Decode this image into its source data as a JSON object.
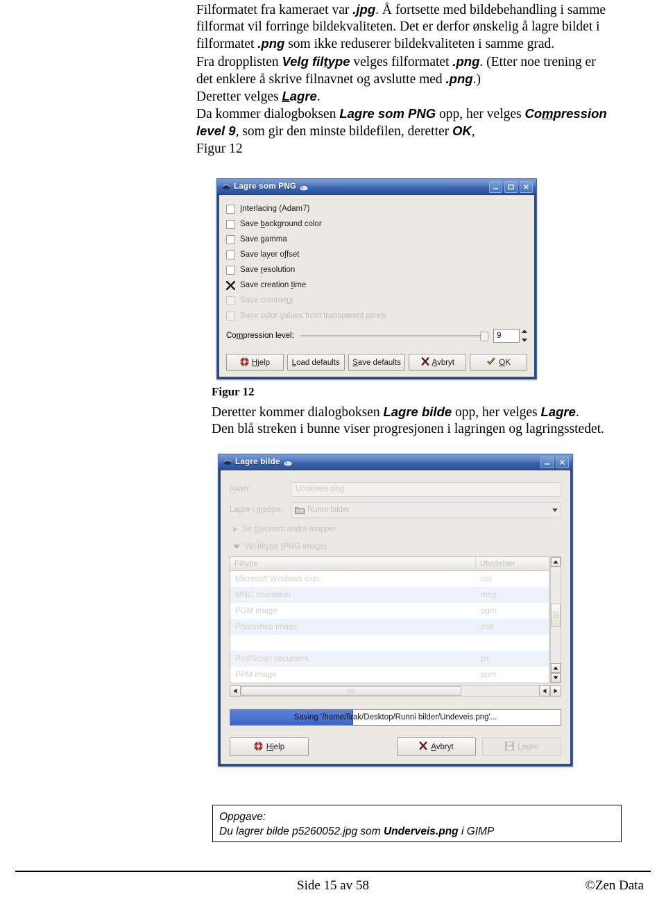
{
  "document": {
    "body_paragraphs": [
      {
        "runs": [
          {
            "t": "Filformatet fra kameraet var ",
            "b": false
          },
          {
            "t": ".jpg",
            "b": true
          },
          {
            "t": ". Å fortsette med bildebehandling i samme filformat vil forringe bildekvaliteten. Det er derfor ønskelig å lagre bildet i filformatet ",
            "b": false
          },
          {
            "t": ".png",
            "b": true
          },
          {
            "t": " som ikke reduserer bildekvaliteten i samme grad.",
            "b": false
          }
        ]
      }
    ],
    "para1_line1": "Filformatet fra kameraet var ",
    "jpg": ".jpg",
    "para1_mid": ". Å fortsette med bildebehandling i samme filformat vil forringe bildekvaliteten. Det er derfor ønskelig å lagre bildet i filformatet ",
    "png1": ".png",
    "para1_end": " som ikke reduserer bildekvaliteten i samme grad.",
    "para2_a": "Fra dropplisten ",
    "velg_filtype": "Velg fil",
    "velg_filtype_u": "t",
    "velg_filtype_rest": "ype",
    "para2_b": " velges filformatet ",
    "png2": ".png",
    "para2_c": ". (Etter noe trening er det enklere å skrive filnavnet og avslutte med ",
    "png3": ".png",
    "para2_d": ".)",
    "para3_a": "Deretter velges ",
    "lagre_L": "L",
    "lagre_rest": "agre",
    "para3_b": ".",
    "para4_a": "Da kommer dialogboksen ",
    "lagre_som_png": "Lagre som PNG",
    "para4_b": " opp, her velges ",
    "compression_m": "Co",
    "compression_u": "m",
    "compression_rest": "pression level 9",
    "para4_c": ", som gir den minste bildefilen, deretter ",
    "ok_bold": "OK",
    "para4_d": ",",
    "figur12_ref": "Figur 12",
    "figure_caption": "Figur 12",
    "para5_a": "Deretter kommer dialogboksen ",
    "lagre_bilde": "Lagre bilde",
    "para5_b": " opp, her velges ",
    "lagre_bold": "Lagre",
    "para5_c": ".",
    "para6": "Den blå streken i bunne viser progresjonen i lagringen og lagringsstedet."
  },
  "png_dialog": {
    "title": "Lagre som PNG",
    "window_buttons": [
      "minimize",
      "maximize",
      "close"
    ],
    "checkboxes": [
      {
        "pre": "",
        "acc": "I",
        "post": "nterlacing (Adam7)",
        "checked": false,
        "disabled": false
      },
      {
        "pre": "Save ",
        "acc": "b",
        "post": "ackground color",
        "checked": false,
        "disabled": false
      },
      {
        "pre": "Save ",
        "acc": "g",
        "post": "amma",
        "checked": false,
        "disabled": false
      },
      {
        "pre": "Save layer o",
        "acc": "f",
        "post": "fset",
        "checked": false,
        "disabled": false
      },
      {
        "pre": "Save ",
        "acc": "r",
        "post": "esolution",
        "checked": false,
        "disabled": false
      },
      {
        "pre": "Save creation ",
        "acc": "t",
        "post": "ime",
        "checked": true,
        "disabled": false
      },
      {
        "pre": "Save comme",
        "acc": "n",
        "post": "t",
        "checked": false,
        "disabled": true
      },
      {
        "pre": "Save color ",
        "acc": "v",
        "post": "alues from transparent pixels",
        "checked": false,
        "disabled": true
      }
    ],
    "compression_label_pre": "Co",
    "compression_label_acc": "m",
    "compression_label_post": "pression level:",
    "compression_value": "9",
    "slider_percent": 100,
    "buttons": [
      {
        "pre": "",
        "acc": "H",
        "post": "jelp",
        "icon": "help-icon",
        "disabled": false
      },
      {
        "pre": "",
        "acc": "L",
        "post": "oad defaults",
        "icon": "none",
        "disabled": false
      },
      {
        "pre": "",
        "acc": "S",
        "post": "ave defaults",
        "icon": "none",
        "disabled": false
      },
      {
        "pre": "",
        "acc": "A",
        "post": "vbryt",
        "icon": "cancel-icon",
        "disabled": false
      },
      {
        "pre": "",
        "acc": "O",
        "post": "K",
        "icon": "ok-icon",
        "disabled": false
      }
    ]
  },
  "save_dialog": {
    "title": "Lagre bilde",
    "window_buttons": [
      "minimize",
      "close"
    ],
    "name_label_acc": "N",
    "name_label_post": "avn:",
    "name_value": "Undeveis.png",
    "folder_label_pre": "Lagre i ",
    "folder_label_acc": "m",
    "folder_label_post": "appe:",
    "folder_value": "Runni bilder",
    "browse_expander": "Se gjennom andre mapper",
    "filetype_expander": "Vel filtype (PNG image)",
    "list_headers": [
      "Filtype",
      "Utvidelser"
    ],
    "list_rows": [
      {
        "name": "Microsoft Windows icon",
        "ext": "ico"
      },
      {
        "name": "MNG animation",
        "ext": "mng"
      },
      {
        "name": "PGM image",
        "ext": "pgm"
      },
      {
        "name": "Photoshop image",
        "ext": "psd"
      },
      {
        "name": "",
        "ext": ""
      },
      {
        "name": "PostScript document",
        "ext": "ps"
      },
      {
        "name": "PPM image",
        "ext": "ppm"
      }
    ],
    "progress_text": "Saving '/home/firak/Desktop/Runni bilder/Undeveis.png'...",
    "progress_percent": 37,
    "buttons": [
      {
        "pre": "",
        "acc": "H",
        "post": "jelp",
        "icon": "help-icon",
        "disabled": false
      },
      {
        "pre": "",
        "acc": "A",
        "post": "vbryt",
        "icon": "cancel-icon",
        "disabled": false
      },
      {
        "pre": "",
        "acc": "L",
        "post": "agre",
        "icon": "save-icon",
        "disabled": true
      }
    ]
  },
  "task_box": {
    "heading": "Oppgave:",
    "line_pre": "Du lagrer bilde p5260052.jpg som ",
    "line_bold": "Underveis.png",
    "line_post": " i GIMP"
  },
  "footer": {
    "page": "Side 15 av 58",
    "copyright": "©Zen Data"
  },
  "colors": {
    "titlebar_blue": "#2b4e96",
    "progress_blue": "#3d64c8",
    "dialog_bg": "#ece9e4",
    "list_alt_row": "#eef3fb"
  }
}
